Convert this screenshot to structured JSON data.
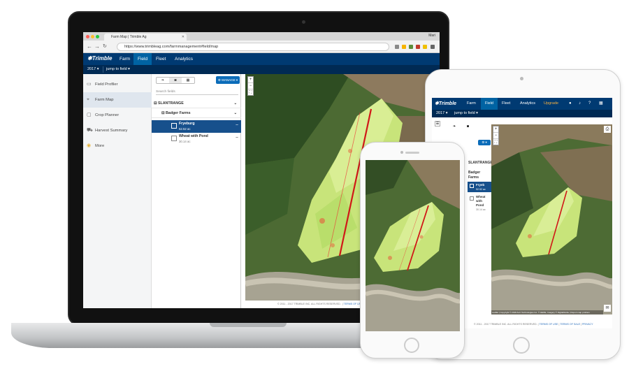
{
  "browser": {
    "tab_title": "Farm Map | Trimble Ag",
    "user": "Mari",
    "url": "https://www.trimbleag.com/farmmanagement#field/map"
  },
  "app": {
    "logo": "Trimble",
    "nav": [
      "Farm",
      "Field",
      "Fleet",
      "Analytics"
    ],
    "active_nav": "Field",
    "upgrade": "Upgrade",
    "year": "2017",
    "jump": "jump to field"
  },
  "sidenav": [
    "Field Profiler",
    "Farm Map",
    "Crop Planner",
    "Harvest Summary",
    "More"
  ],
  "panel": {
    "manage": "MANAGE",
    "search_placeholder": "Search fields",
    "group": "SLANTRANGE",
    "farm": "Badger Farms",
    "fields": [
      {
        "name": "Fryeburg",
        "area": "52.52 ac"
      },
      {
        "name": "Wheat with Pond",
        "area": "30.14 ac"
      }
    ]
  },
  "footer": {
    "copyright": "© 2011 - 2017 TRIMBLE INC. ALL RIGHTS RESERVED.",
    "terms": "TERMS OF USE",
    "terms_sale": "TERMS OF SALE",
    "privacy": "PRIVACY"
  },
  "tablet": {
    "year": "2017",
    "jump": "jump to field",
    "group": "SLANTRANGE",
    "farm_l1": "Badger",
    "farm_l2": "Farms",
    "field1_name": "Fryeb",
    "field1_area": "52.52 ac",
    "field2_l1": "Wheat",
    "field2_l2": "with",
    "field2_l3": "Pond",
    "field2_area": "30.14 ac",
    "attribution": "Leaflet | Copyright © 2018 ALK Technologies Inc. © HERE, Imagery © DigitalGlobe | Report map problem"
  }
}
